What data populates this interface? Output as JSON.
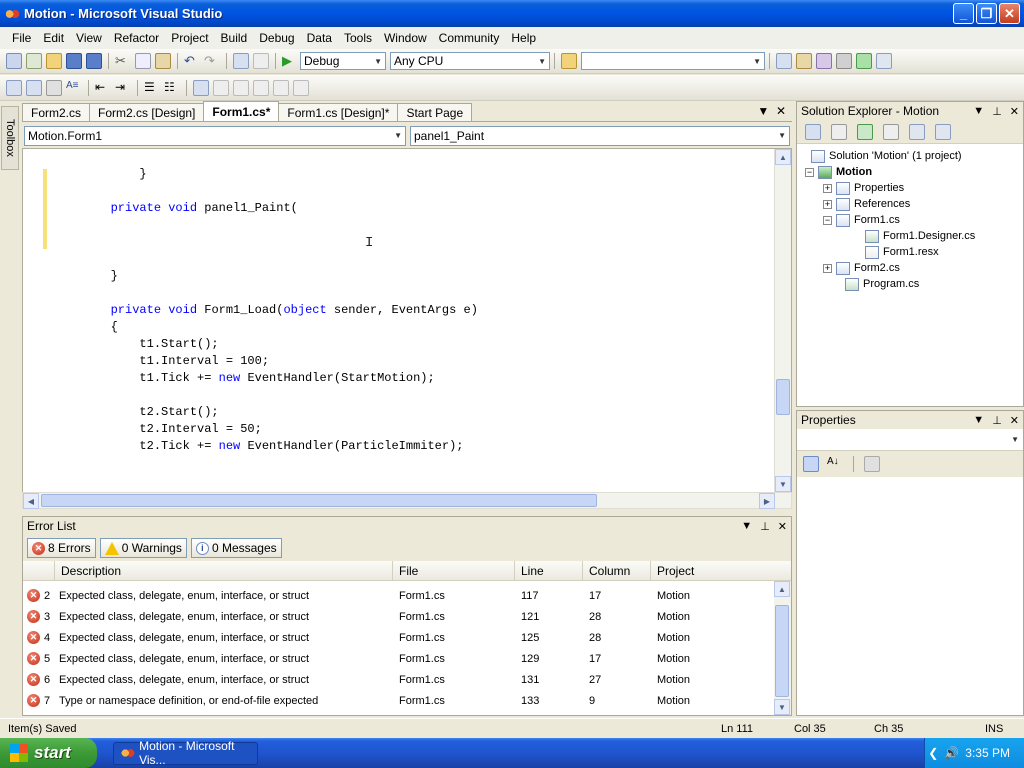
{
  "window": {
    "title": "Motion - Microsoft Visual Studio"
  },
  "menu": [
    "File",
    "Edit",
    "View",
    "Refactor",
    "Project",
    "Build",
    "Debug",
    "Data",
    "Tools",
    "Window",
    "Community",
    "Help"
  ],
  "toolbar": {
    "config": "Debug",
    "platform": "Any CPU",
    "find_value": ""
  },
  "doc_tabs": [
    {
      "label": "Form2.cs",
      "active": false
    },
    {
      "label": "Form2.cs [Design]",
      "active": false
    },
    {
      "label": "Form1.cs*",
      "active": true
    },
    {
      "label": "Form1.cs [Design]*",
      "active": false
    },
    {
      "label": "Start Page",
      "active": false
    }
  ],
  "toolbox_label": "Toolbox",
  "nav": {
    "class": "Motion.Form1",
    "member": "panel1_Paint"
  },
  "code_lines": [
    [
      {
        "t": ""
      }
    ],
    [
      {
        "t": "            }"
      }
    ],
    [
      {
        "t": ""
      }
    ],
    [
      {
        "t": "        "
      },
      {
        "t": "private",
        "k": 1
      },
      {
        "t": " "
      },
      {
        "t": "void",
        "k": 1
      },
      {
        "t": " panel1_Paint("
      }
    ],
    [
      {
        "t": ""
      }
    ],
    [
      {
        "t": ""
      }
    ],
    [
      {
        "t": ""
      }
    ],
    [
      {
        "t": "        }"
      }
    ],
    [
      {
        "t": ""
      }
    ],
    [
      {
        "t": "        "
      },
      {
        "t": "private",
        "k": 1
      },
      {
        "t": " "
      },
      {
        "t": "void",
        "k": 1
      },
      {
        "t": " Form1_Load("
      },
      {
        "t": "object",
        "k": 1
      },
      {
        "t": " sender, EventArgs e)"
      }
    ],
    [
      {
        "t": "        {"
      }
    ],
    [
      {
        "t": "            t1.Start();"
      }
    ],
    [
      {
        "t": "            t1.Interval = 100;"
      }
    ],
    [
      {
        "t": "            t1.Tick += "
      },
      {
        "t": "new",
        "k": 1
      },
      {
        "t": " EventHandler(StartMotion);"
      }
    ],
    [
      {
        "t": ""
      }
    ],
    [
      {
        "t": "            t2.Start();"
      }
    ],
    [
      {
        "t": "            t2.Interval = 50;"
      }
    ],
    [
      {
        "t": "            t2.Tick += "
      },
      {
        "t": "new",
        "k": 1
      },
      {
        "t": " EventHandler(ParticleImmiter);"
      }
    ]
  ],
  "error_list": {
    "title": "Error List",
    "errors_btn": "8 Errors",
    "warnings_btn": "0 Warnings",
    "messages_btn": "0 Messages",
    "columns": [
      "Description",
      "File",
      "Line",
      "Column",
      "Project"
    ],
    "rows": [
      {
        "n": "2",
        "desc": "Expected class, delegate, enum, interface, or struct",
        "file": "Form1.cs",
        "line": "117",
        "col": "17",
        "proj": "Motion"
      },
      {
        "n": "3",
        "desc": "Expected class, delegate, enum, interface, or struct",
        "file": "Form1.cs",
        "line": "121",
        "col": "28",
        "proj": "Motion"
      },
      {
        "n": "4",
        "desc": "Expected class, delegate, enum, interface, or struct",
        "file": "Form1.cs",
        "line": "125",
        "col": "28",
        "proj": "Motion"
      },
      {
        "n": "5",
        "desc": "Expected class, delegate, enum, interface, or struct",
        "file": "Form1.cs",
        "line": "129",
        "col": "17",
        "proj": "Motion"
      },
      {
        "n": "6",
        "desc": "Expected class, delegate, enum, interface, or struct",
        "file": "Form1.cs",
        "line": "131",
        "col": "27",
        "proj": "Motion"
      },
      {
        "n": "7",
        "desc": "Type or namespace definition, or end-of-file expected",
        "file": "Form1.cs",
        "line": "133",
        "col": "9",
        "proj": "Motion"
      }
    ]
  },
  "solution_explorer": {
    "title": "Solution Explorer - Motion",
    "solution": "Solution 'Motion' (1 project)",
    "project": "Motion",
    "properties": "Properties",
    "references": "References",
    "form1": "Form1.cs",
    "form1_designer": "Form1.Designer.cs",
    "form1_resx": "Form1.resx",
    "form2": "Form2.cs",
    "program": "Program.cs"
  },
  "properties_pane": {
    "title": "Properties"
  },
  "status": {
    "message": "Item(s) Saved",
    "ln": "Ln 111",
    "col": "Col 35",
    "ch": "Ch 35",
    "mode": "INS"
  },
  "taskbar": {
    "start": "start",
    "item": "Motion - Microsoft Vis...",
    "clock": "3:35 PM"
  },
  "colors": {
    "keyword": "#0000ff",
    "title_blue": "#0054e3",
    "start_green": "#3c9a36"
  }
}
